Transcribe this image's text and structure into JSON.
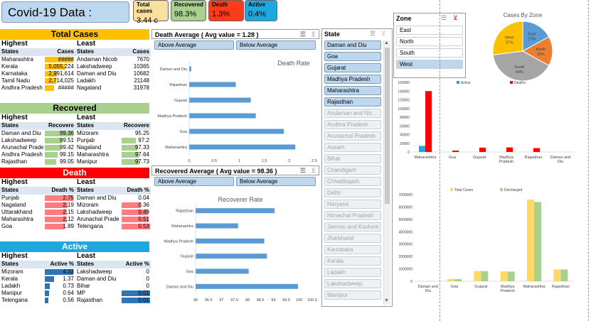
{
  "title": "Covid-19 Data :",
  "kpis": [
    {
      "label": "Total cases",
      "value": "3.44 c",
      "color": "#f9e09c"
    },
    {
      "label": "Recovered",
      "value": "98.3%",
      "color": "#a9d18e"
    },
    {
      "label": "Death",
      "value": "1.3%",
      "color": "#ff3b1a"
    },
    {
      "label": "Active",
      "value": "0.4%",
      "color": "#1fa8e0"
    }
  ],
  "total_cases": {
    "title": "Total Cases",
    "highest": "Highest",
    "least": "Least",
    "headers": [
      "States",
      "Cases",
      "States",
      "Cases"
    ],
    "rows": [
      [
        "Maharashtra",
        "#####",
        "Andaman Nicob",
        "7670"
      ],
      [
        "Kerala",
        "5,055,224",
        "Lakshadweep",
        "10365"
      ],
      [
        "Karnataka",
        "2,991,614",
        "Daman and Diu",
        "10682"
      ],
      [
        "Tamil Nadu",
        "2,714,025",
        "Ladakh",
        "21148"
      ],
      [
        "Andhra Pradesh",
        "#####",
        "Nagaland",
        "31978"
      ]
    ],
    "bar_frac": [
      1.0,
      0.72,
      0.43,
      0.39,
      0.33
    ]
  },
  "recovered": {
    "title": "Recovered",
    "highest": "Highest",
    "least": "Least",
    "headers": [
      "States",
      "Recovere",
      "States",
      "Recovere"
    ],
    "rows": [
      [
        "Daman and Diu",
        "99.36",
        "Mizoram",
        "95.25"
      ],
      [
        "Lakshadweep",
        "99.51",
        "Punjab",
        "97.2"
      ],
      [
        "Arunachal Prade",
        "99.42",
        "Nagaland",
        "97.33"
      ],
      [
        "Andhra Pradesh",
        "99.15",
        "Maharashtra",
        "97.64"
      ],
      [
        "Rajasthan",
        "99.05",
        "Manipur",
        "97.73"
      ]
    ],
    "bar_frac_h": [
      1.0,
      0.6,
      0.55,
      0.45,
      0.4
    ],
    "bar_frac_l": [
      0.0,
      0.5,
      0.55,
      0.6,
      0.62
    ]
  },
  "death": {
    "title": "Death",
    "highest": "Highest",
    "least": "Least",
    "headers": [
      "States",
      "Death %",
      "States",
      "Death %"
    ],
    "rows": [
      [
        "Punjab",
        "2.75",
        "Daman and Diu",
        "0.04"
      ],
      [
        "Nagaland",
        "2.19",
        "Mizoram",
        "0.36"
      ],
      [
        "Uttarakhand",
        "2.15",
        "Lakshadweep",
        "0.49"
      ],
      [
        "Maharashtra",
        "2.12",
        "Arunachal Prade",
        "0.51"
      ],
      [
        "Goa",
        "1.89",
        "Telengana",
        "0.53"
      ]
    ],
    "bar_frac_h": [
      1.0,
      0.8,
      0.78,
      0.77,
      0.69
    ],
    "bar_frac_l": [
      0.0,
      0.68,
      0.92,
      0.96,
      1.0
    ]
  },
  "active": {
    "title": "Active",
    "highest": "Highest",
    "least": "Least",
    "headers": [
      "States",
      "Active %",
      "States",
      "Active %"
    ],
    "rows": [
      [
        "Mizoram",
        "4.33",
        "Lakshadweep",
        "0"
      ],
      [
        "Kerala",
        "1.37",
        "Daman and Diu",
        "0"
      ],
      [
        "Ladakh",
        "0.73",
        "Bihar",
        "0"
      ],
      [
        "Manipur",
        "0.64",
        "MP",
        "0.01"
      ],
      [
        "Telengana",
        "0.56",
        "Rajasthan",
        "0.01"
      ]
    ],
    "bar_frac_h": [
      1.0,
      0.32,
      0.17,
      0.15,
      0.13
    ],
    "bar_frac_l": [
      0.0,
      0.0,
      0.0,
      1.0,
      1.0
    ]
  },
  "death_avg": {
    "header": "Death Average ( Avg value = 1.28 )",
    "btn_above": "Above Average",
    "btn_below": "Below Average"
  },
  "recovered_avg": {
    "header": "Recovered Average ( Avg value = 98.36 )",
    "btn_above": "Above Average",
    "btn_below": "Below Average"
  },
  "state_slicer": {
    "header": "State",
    "items": [
      {
        "label": "Daman and Diu",
        "selected": true
      },
      {
        "label": "Goa",
        "selected": true
      },
      {
        "label": "Gujarat",
        "selected": true
      },
      {
        "label": "Madhya Pradesh",
        "selected": true
      },
      {
        "label": "Maharashtra",
        "selected": true
      },
      {
        "label": "Rajasthan",
        "selected": true
      },
      {
        "label": "Andaman and Nic...",
        "selected": false
      },
      {
        "label": "Andhra Pradesh",
        "selected": false
      },
      {
        "label": "Arunachal Pradesh",
        "selected": false
      },
      {
        "label": "Assam",
        "selected": false
      },
      {
        "label": "Bihar",
        "selected": false
      },
      {
        "label": "Chandigarh",
        "selected": false
      },
      {
        "label": "Chhattisgarh",
        "selected": false
      },
      {
        "label": "Delhi",
        "selected": false
      },
      {
        "label": "Haryana",
        "selected": false
      },
      {
        "label": "Himachal Pradesh",
        "selected": false
      },
      {
        "label": "Jammu and Kashmir",
        "selected": false
      },
      {
        "label": "Jharkhand",
        "selected": false
      },
      {
        "label": "Karnataka",
        "selected": false
      },
      {
        "label": "Kerala",
        "selected": false
      },
      {
        "label": "Ladakh",
        "selected": false
      },
      {
        "label": "Lakshadweep",
        "selected": false
      },
      {
        "label": "Manipur",
        "selected": false
      }
    ]
  },
  "zone_slicer": {
    "header": "Zone",
    "items": [
      {
        "label": "East",
        "selected": false
      },
      {
        "label": "North",
        "selected": false
      },
      {
        "label": "South",
        "selected": false
      },
      {
        "label": "West",
        "selected": true
      }
    ]
  },
  "chart_data": [
    {
      "type": "bar",
      "title": "Death Rate",
      "categories": [
        "Daman and Diu",
        "Rajasthan",
        "Gujarat",
        "Madhya Pradesh",
        "Goa",
        "Maharashtra"
      ],
      "values": [
        0.04,
        0.93,
        1.23,
        1.33,
        1.89,
        2.12
      ],
      "xlim": [
        0,
        2.5
      ],
      "ticks": [
        "0",
        "0.5",
        "1",
        "1.5",
        "2",
        "2.5"
      ],
      "color": "#5b9bd5"
    },
    {
      "type": "bar",
      "title": "Recoverer Rate",
      "categories": [
        "Rajasthan",
        "Maharashtra",
        "Madhya Pradesh",
        "Gujarat",
        "Goa",
        "Daman and Diu"
      ],
      "values": [
        99.05,
        97.64,
        98.65,
        98.75,
        98.05,
        99.95
      ],
      "xlim": [
        96,
        100.5
      ],
      "ticks": [
        "96",
        "96.5",
        "97",
        "97.5",
        "98",
        "98.5",
        "99",
        "99.5",
        "100",
        "100.5"
      ],
      "color": "#5b9bd5"
    },
    {
      "type": "pie",
      "title": "Cases By Zone",
      "slices": [
        {
          "name": "East",
          "value": 17,
          "label": "East\n17%",
          "color": "#5b9bd5"
        },
        {
          "name": "North",
          "value": 16,
          "label": "North\n16%",
          "color": "#ed7d31"
        },
        {
          "name": "South",
          "value": 40,
          "label": "South\n40%",
          "color": "#a5a5a5"
        },
        {
          "name": "West",
          "value": 27,
          "label": "West\n27%",
          "color": "#ffc000"
        }
      ]
    },
    {
      "type": "bar",
      "legend": [
        "Active",
        "Deaths"
      ],
      "categories": [
        "Maharashtra",
        "Goa",
        "Gujarat",
        "Madhya Pradesh",
        "Rajasthan",
        "Daman and Diu"
      ],
      "series": [
        {
          "name": "Active",
          "values": [
            14000,
            0,
            0,
            0,
            0,
            0
          ],
          "color": "#1fa8e0"
        },
        {
          "name": "Deaths",
          "values": [
            140000,
            3200,
            10000,
            10500,
            9000,
            0
          ],
          "color": "#ff0000"
        }
      ],
      "ylim": [
        0,
        160000
      ],
      "ticks": [
        "0",
        "20000",
        "40000",
        "60000",
        "80000",
        "100000",
        "120000",
        "140000",
        "160000"
      ]
    },
    {
      "type": "bar",
      "legend": [
        "Total Cases",
        "Discharged"
      ],
      "categories": [
        "Daman and Diu",
        "Goa",
        "Gujarat",
        "Madhya Pradesh",
        "Maharashtra",
        "Rajasthan"
      ],
      "series": [
        {
          "name": "Total Cases",
          "values": [
            10682,
            180000,
            825000,
            793000,
            6600000,
            954000
          ],
          "color": "#ffd966"
        },
        {
          "name": "Discharged",
          "values": [
            10600,
            175000,
            815000,
            782000,
            6400000,
            945000
          ],
          "color": "#a9d18e"
        }
      ],
      "ylim": [
        0,
        7000000
      ],
      "ticks": [
        "0",
        "1000000",
        "2000000",
        "3000000",
        "4000000",
        "5000000",
        "6000000",
        "7000000"
      ]
    }
  ]
}
